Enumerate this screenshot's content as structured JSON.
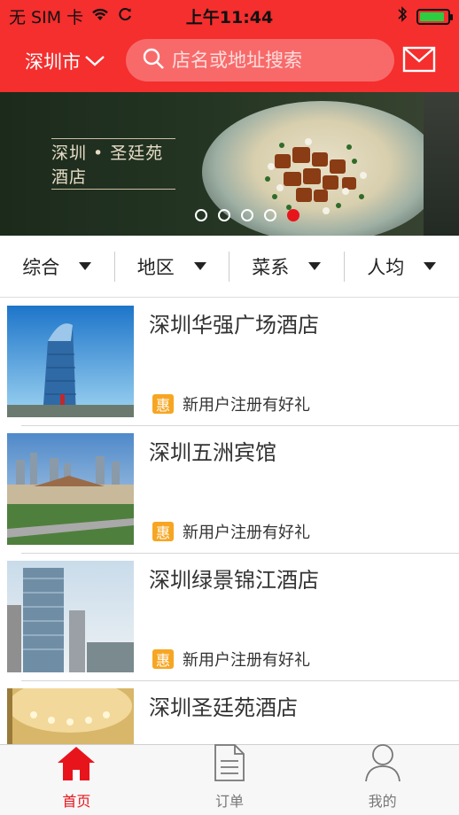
{
  "status_bar": {
    "carrier": "无 SIM 卡",
    "time": "上午11:44",
    "battery_level": 0.9,
    "icons": [
      "wifi-icon",
      "sync-icon",
      "bluetooth-icon",
      "battery-charging-icon"
    ]
  },
  "header": {
    "city": "深圳市",
    "search_placeholder": "店名或地址搜索",
    "icons": [
      "chevron-down-icon",
      "search-icon",
      "mail-icon"
    ]
  },
  "banner": {
    "title": "深圳 • 圣廷苑酒店",
    "dot_count": 5,
    "active_dot": 5
  },
  "filters": [
    {
      "label": "综合"
    },
    {
      "label": "地区"
    },
    {
      "label": "菜系"
    },
    {
      "label": "人均"
    }
  ],
  "hotels": [
    {
      "name": "深圳华强广场酒店",
      "badge": "惠",
      "promo": "新用户注册有好礼"
    },
    {
      "name": "深圳五洲宾馆",
      "badge": "惠",
      "promo": "新用户注册有好礼"
    },
    {
      "name": "深圳绿景锦江酒店",
      "badge": "惠",
      "promo": "新用户注册有好礼"
    },
    {
      "name": "深圳圣廷苑酒店"
    }
  ],
  "tabs": [
    {
      "label": "首页",
      "icon": "home-icon",
      "active": true
    },
    {
      "label": "订单",
      "icon": "document-icon",
      "active": false
    },
    {
      "label": "我的",
      "icon": "user-icon",
      "active": false
    }
  ],
  "colors": {
    "brand_red": "#f52e2e",
    "active_red": "#e8141c",
    "promo_badge": "#f6a623"
  }
}
